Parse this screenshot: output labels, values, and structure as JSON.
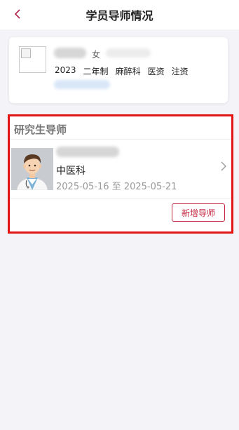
{
  "header": {
    "title": "学员导师情况",
    "back_icon": "chevron-left-icon",
    "back_color": "#b0244a"
  },
  "student": {
    "gender": "女",
    "tags": [
      "2023",
      "二年制",
      "麻醉科",
      "医资",
      "注资"
    ]
  },
  "mentor_section": {
    "title": "研究生导师",
    "mentors": [
      {
        "department": "中医科",
        "date_range": "2025-05-16 至 2025-05-21"
      }
    ],
    "add_button_label": "新增导师",
    "accent_color": "#c4243f",
    "highlight_color": "#e01414"
  }
}
